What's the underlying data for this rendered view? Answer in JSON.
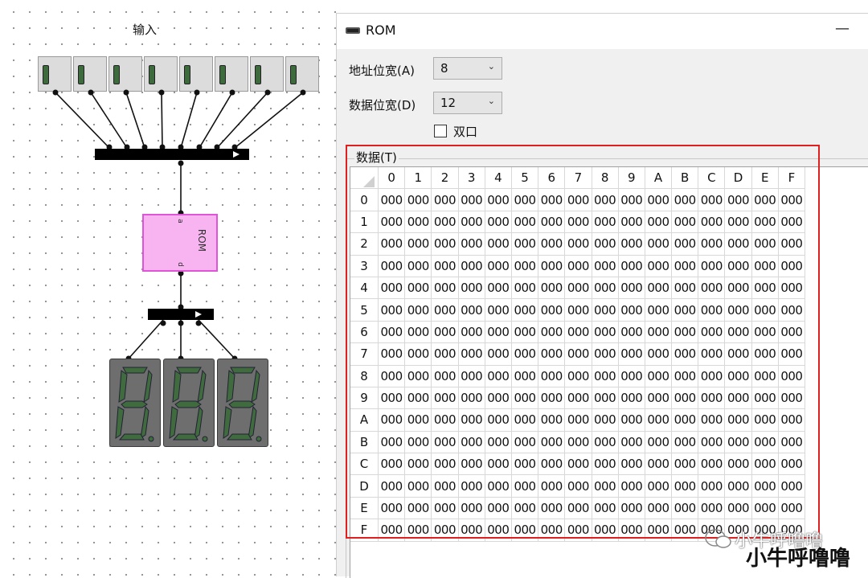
{
  "canvas": {
    "input_label": "输入",
    "rom_chip_label": "ROM",
    "rom_pin_a": "a",
    "rom_pin_d": "d"
  },
  "dialog": {
    "title": "ROM",
    "minimize_glyph": "—",
    "address_width": {
      "label": "地址位宽(A)",
      "value": "8"
    },
    "data_width": {
      "label": "数据位宽(D)",
      "value": "12"
    },
    "dual_port": {
      "label": "双口",
      "checked": false
    },
    "data_group_label": "数据(T)",
    "grid": {
      "column_headers": [
        "0",
        "1",
        "2",
        "3",
        "4",
        "5",
        "6",
        "7",
        "8",
        "9",
        "A",
        "B",
        "C",
        "D",
        "E",
        "F"
      ],
      "row_headers": [
        "0",
        "1",
        "2",
        "3",
        "4",
        "5",
        "6",
        "7",
        "8",
        "9",
        "A",
        "B",
        "C",
        "D",
        "E",
        "F"
      ],
      "cell_value": "000"
    }
  },
  "watermark": {
    "line1": "小牛呼噜噜",
    "line2": "小牛呼噜噜"
  },
  "colors": {
    "highlight_frame": "#e02020",
    "rom_chip_fill": "#f7b4f0",
    "seg_display": "#6e6e6e"
  },
  "icons": [
    "rom-chip-icon",
    "chevron-down-icon",
    "wechat-icon"
  ]
}
